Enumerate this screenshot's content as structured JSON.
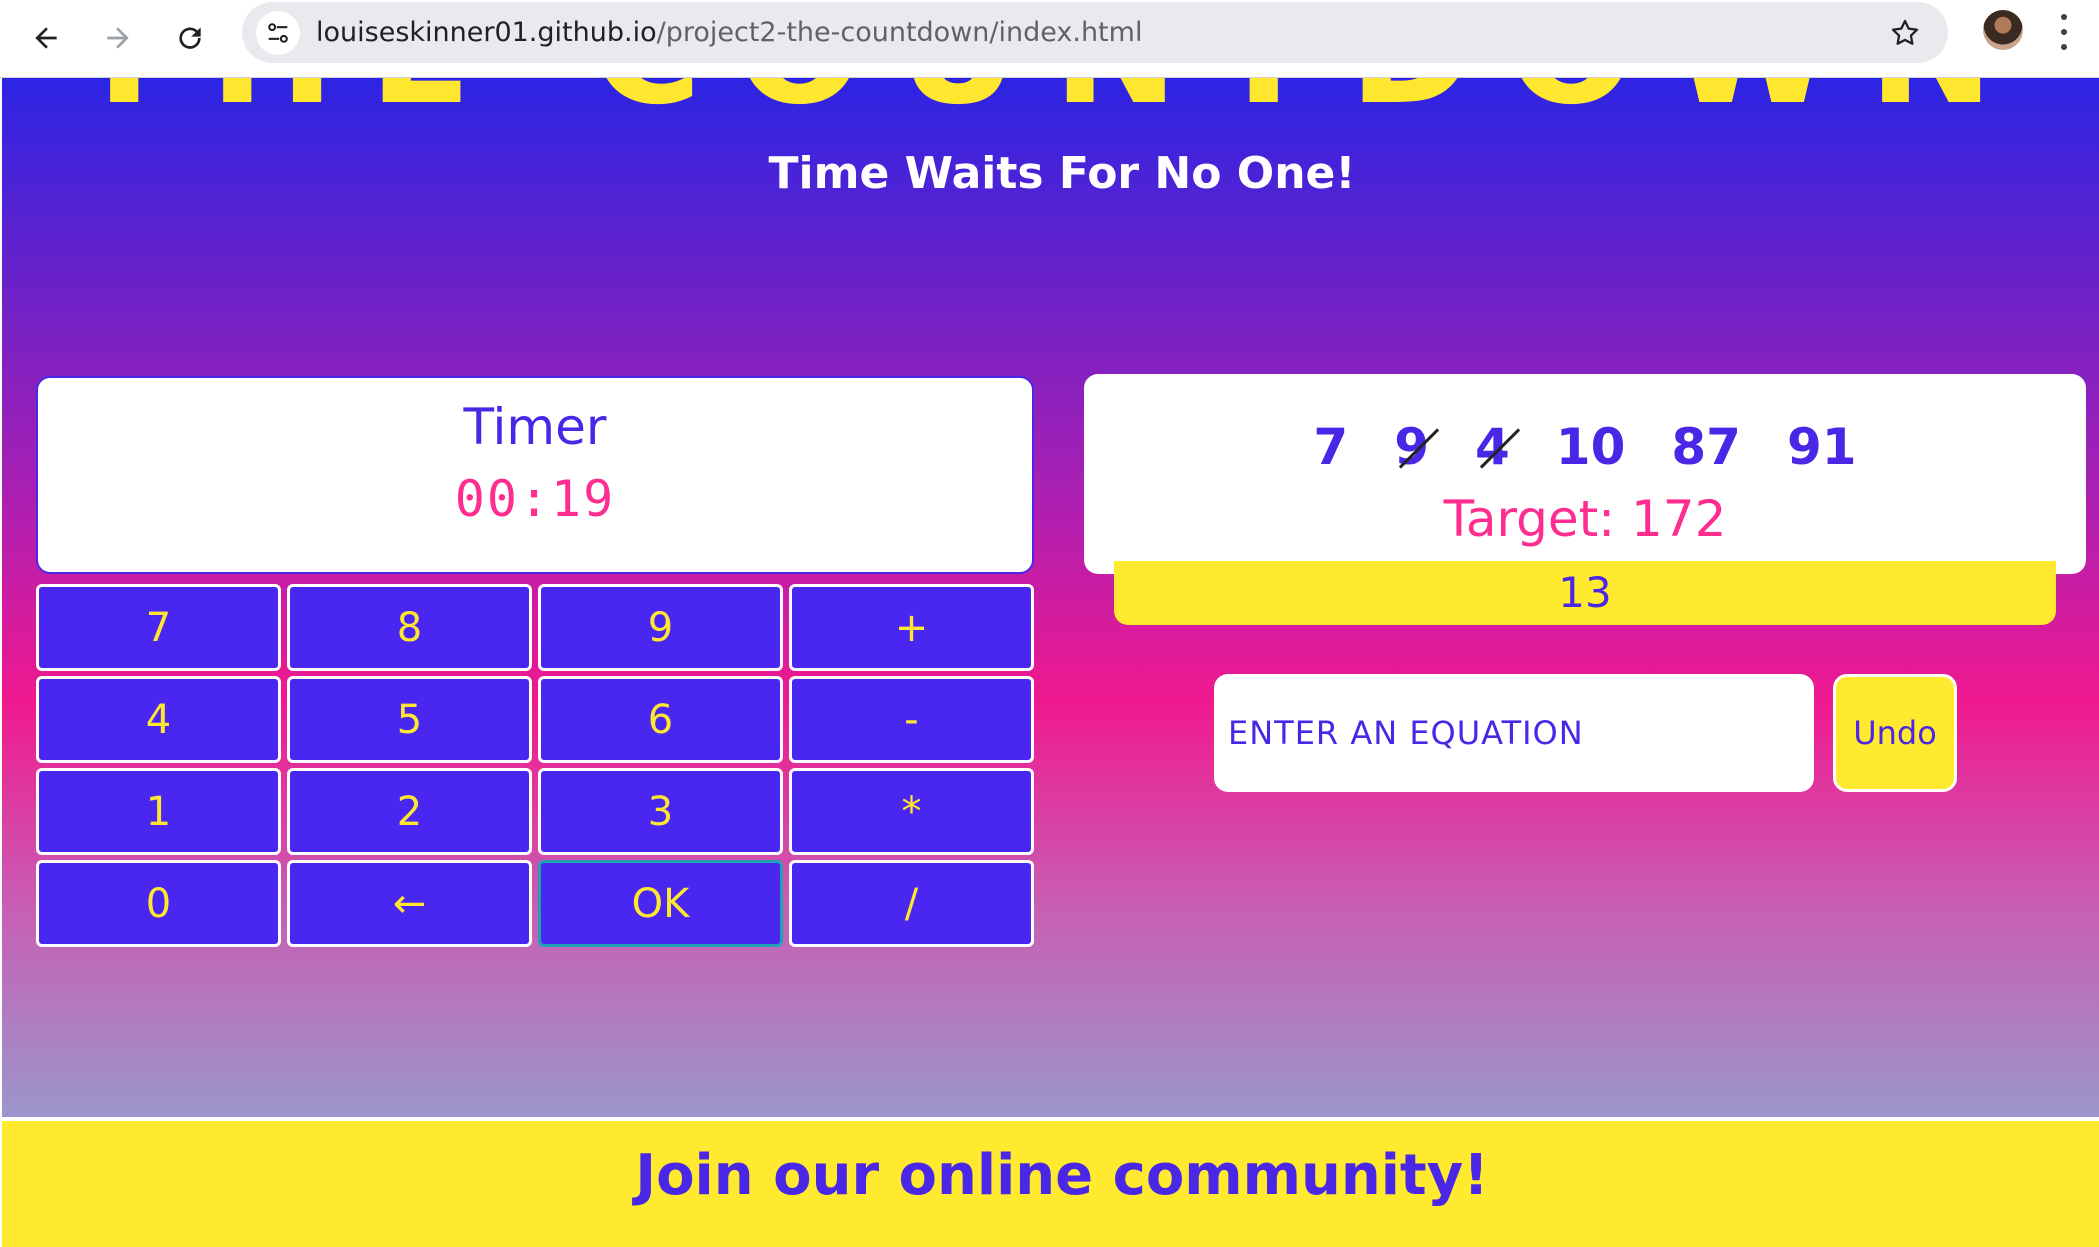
{
  "browser": {
    "url_host": "louiseskinner01.github.io",
    "url_path": "/project2-the-countdown/index.html"
  },
  "header": {
    "title": "THE COUNTDOWN",
    "tagline": "Time Waits For No One!"
  },
  "timer": {
    "label": "Timer",
    "value": "00:19"
  },
  "keypad": {
    "keys": [
      "7",
      "8",
      "9",
      "+",
      "4",
      "5",
      "6",
      "-",
      "1",
      "2",
      "3",
      "*",
      "0",
      "←",
      "OK",
      "/"
    ]
  },
  "game": {
    "numbers": [
      {
        "value": "7",
        "used": false
      },
      {
        "value": "9",
        "used": true
      },
      {
        "value": "4",
        "used": true
      },
      {
        "value": "10",
        "used": false
      },
      {
        "value": "87",
        "used": false
      },
      {
        "value": "91",
        "used": false
      }
    ],
    "target": "Target: 172",
    "result": "13",
    "equation_placeholder": "ENTER AN EQUATION",
    "undo_label": "Undo"
  },
  "footer": {
    "text": "Join our online community!"
  },
  "colors": {
    "accent_blue": "#4a27e6",
    "accent_yellow": "#ffe72f",
    "accent_pink": "#ff2d8f"
  }
}
